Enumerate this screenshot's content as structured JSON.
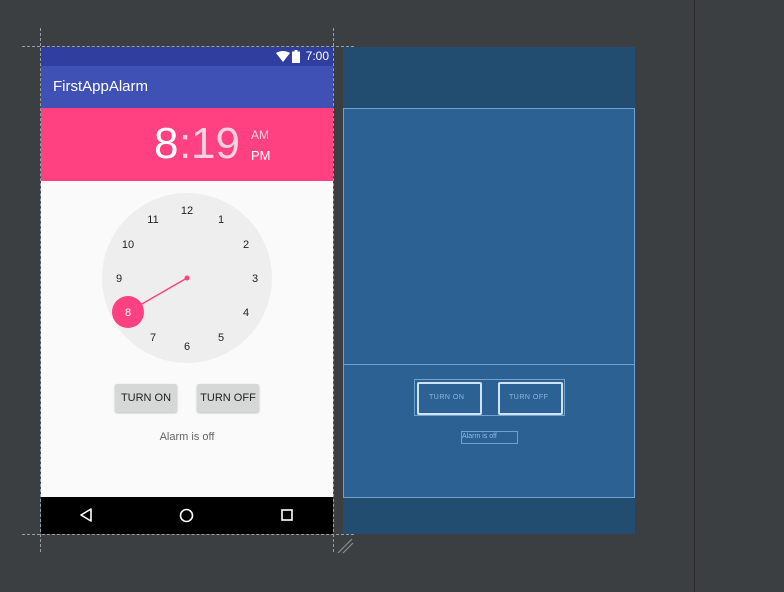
{
  "app": {
    "title": "FirstAppAlarm",
    "status_time": "7:00"
  },
  "time_picker": {
    "hour": "8",
    "separator": ":",
    "minute": "19",
    "am_label": "AM",
    "pm_label": "PM",
    "selected_hour": "8",
    "dial_numbers": [
      "12",
      "1",
      "2",
      "3",
      "4",
      "5",
      "6",
      "7",
      "8",
      "9",
      "10",
      "11"
    ]
  },
  "buttons": {
    "turn_on": "TURN ON",
    "turn_off": "TURN OFF"
  },
  "status": {
    "text": "Alarm is off"
  },
  "blueprint": {
    "turn_on": "TURN ON",
    "turn_off": "TURN OFF",
    "status": "Alarm is off"
  },
  "colors": {
    "primary": "#3f51b5",
    "primary_dark": "#303f9f",
    "accent": "#ff4081",
    "blueprint_bg": "#224c70"
  },
  "icons": [
    "wifi-icon",
    "battery-icon",
    "back-icon",
    "home-icon",
    "recents-icon"
  ]
}
